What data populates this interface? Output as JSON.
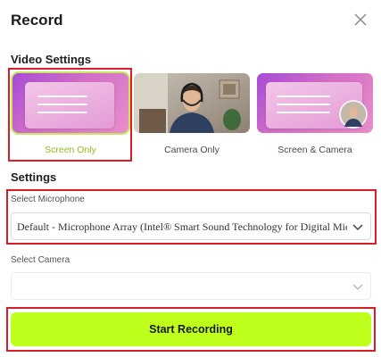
{
  "dialog": {
    "title": "Record",
    "close_icon": "close-icon"
  },
  "video_settings": {
    "heading": "Video Settings",
    "options": [
      {
        "label": "Screen Only",
        "selected": true
      },
      {
        "label": "Camera Only",
        "selected": false
      },
      {
        "label": "Screen & Camera",
        "selected": false
      }
    ]
  },
  "settings": {
    "heading": "Settings",
    "microphone": {
      "label": "Select Microphone",
      "value": "Default - Microphone Array (Intel® Smart Sound Technology for Digital Microphones)"
    },
    "camera": {
      "label": "Select Camera",
      "value": ""
    }
  },
  "start_button": {
    "label": "Start Recording"
  },
  "colors": {
    "accent": "#bfff1c",
    "selected_text": "#8fbf1c",
    "highlight_box": "#d81e27"
  }
}
